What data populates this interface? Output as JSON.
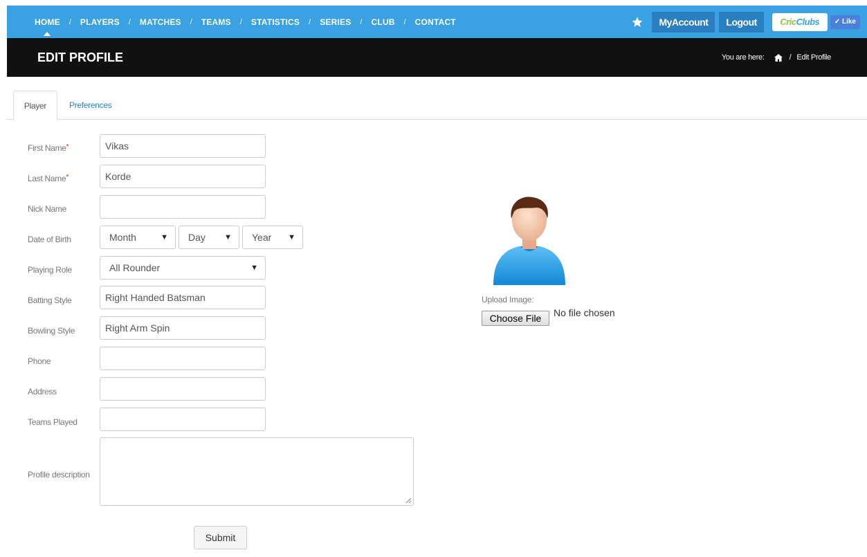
{
  "nav": {
    "links": [
      "HOME",
      "PLAYERS",
      "MATCHES",
      "TEAMS",
      "STATISTICS",
      "SERIES",
      "CLUB",
      "CONTACT"
    ],
    "separator": "/",
    "my_account": "MyAccount",
    "logout": "Logout",
    "logo_text_a": "Cric",
    "logo_text_b": "Clubs",
    "like": "✓ Like",
    "accent_color": "#3aa2e2"
  },
  "titlebar": {
    "title": "EDIT PROFILE",
    "breadcrumb_prefix": "You are here:",
    "breadcrumb_sep": "/",
    "breadcrumb_current": "Edit Profile"
  },
  "tabs": {
    "player": "Player",
    "preferences": "Preferences"
  },
  "form": {
    "first_name_label": "First Name",
    "first_name_value": "Vikas",
    "last_name_label": "Last Name",
    "last_name_value": "Korde",
    "nick_name_label": "Nick Name",
    "nick_name_value": "",
    "dob_label": "Date of Birth",
    "dob_month": "Month",
    "dob_day": "Day",
    "dob_year": "Year",
    "playing_role_label": "Playing Role",
    "playing_role_value": "All Rounder",
    "batting_style_label": "Batting Style",
    "batting_style_value": "Right Handed Batsman",
    "bowling_style_label": "Bowling Style",
    "bowling_style_value": "Right Arm Spin",
    "phone_label": "Phone",
    "phone_value": "",
    "address_label": "Address",
    "address_value": "",
    "teams_played_label": "Teams Played",
    "teams_played_value": "",
    "profile_description_label": "Profile description",
    "required_mark": "*",
    "submit": "Submit"
  },
  "upload": {
    "label": "Upload Image:",
    "button": "Choose File",
    "status": "No file chosen"
  }
}
